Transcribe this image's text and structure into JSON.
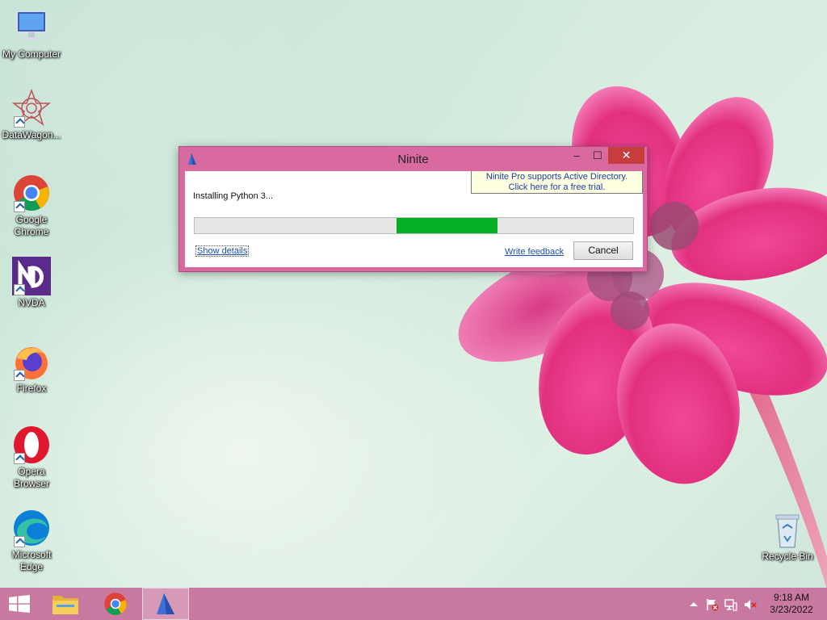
{
  "desktop": {
    "icons": [
      {
        "label": "My Computer",
        "icon": "computer-icon"
      },
      {
        "label": "DataWagon...",
        "icon": "datawagon-icon"
      },
      {
        "label": "Google Chrome",
        "icon": "chrome-icon"
      },
      {
        "label": "NVDA",
        "icon": "nvda-icon"
      },
      {
        "label": "Firefox",
        "icon": "firefox-icon"
      },
      {
        "label": "Opera Browser",
        "icon": "opera-icon"
      },
      {
        "label": "Microsoft Edge",
        "icon": "edge-icon"
      },
      {
        "label": "Recycle Bin",
        "icon": "recycle-bin-icon"
      }
    ]
  },
  "window": {
    "title": "Ninite",
    "minimize_symbol": "–",
    "maximize_symbol": "☐",
    "close_symbol": "✕",
    "promo_line1": "Ninite Pro supports Active Directory.",
    "promo_line2": "Click here for a free trial.",
    "status": "Installing Python 3...",
    "progress": {
      "fill_start": 0.46,
      "fill_end": 0.69,
      "style": "marquee",
      "color": "#06b025"
    },
    "show_details": "Show details",
    "write_feedback": "Write feedback",
    "cancel": "Cancel"
  },
  "taskbar": {
    "items": [
      {
        "icon": "windows-start-icon"
      },
      {
        "icon": "file-explorer-icon"
      },
      {
        "icon": "chrome-icon"
      },
      {
        "icon": "ninite-icon",
        "active": true
      }
    ],
    "tray": [
      "show-hidden-icons",
      "action-center-flag-icon",
      "network-icon",
      "volume-muted-icon"
    ],
    "time": "9:18 AM",
    "date": "3/23/2022"
  },
  "colors": {
    "window_frame": "#d96aa0",
    "taskbar": "#c9799f",
    "close_button": "#c73d3d",
    "progress": "#06b025",
    "link": "#1a4fb0"
  }
}
